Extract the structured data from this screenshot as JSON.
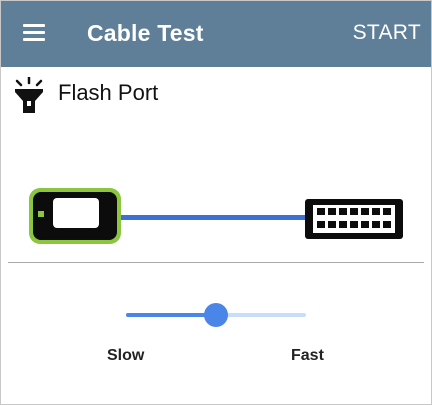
{
  "appbar": {
    "title": "Cable Test",
    "action_label": "START",
    "color": "#5f7f99"
  },
  "section": {
    "title": "Flash Port",
    "icon": "flashlight-icon"
  },
  "diagram": {
    "left_device_icon": "tester-device-icon",
    "right_device_icon": "switch-port-icon",
    "link_color": "#3d6fd6",
    "device_accent": "#8cc63f"
  },
  "speed": {
    "min_label": "Slow",
    "max_label": "Fast",
    "value_fraction": 0.5,
    "accent": "#4a86e8",
    "track_inactive": "#c9ddf6"
  }
}
